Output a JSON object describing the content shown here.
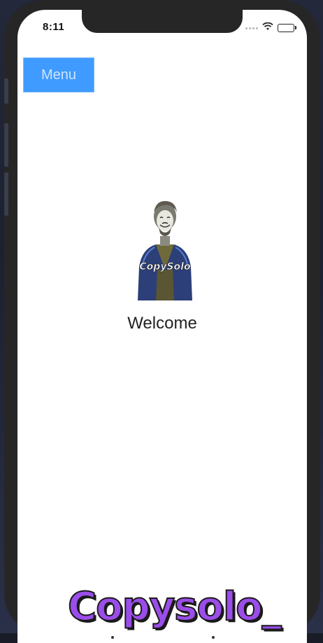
{
  "status_bar": {
    "time": "8:11"
  },
  "menu_button": {
    "label": "Menu"
  },
  "avatar": {
    "caption": "CopySolo"
  },
  "main": {
    "welcome": "Welcome"
  },
  "watermark": {
    "text": "Copysolo_"
  },
  "colors": {
    "menu_button_bg": "#3f9bff",
    "watermark": "#9b4dea"
  },
  "icons": [
    "signal-icon",
    "wifi-icon",
    "battery-icon"
  ]
}
